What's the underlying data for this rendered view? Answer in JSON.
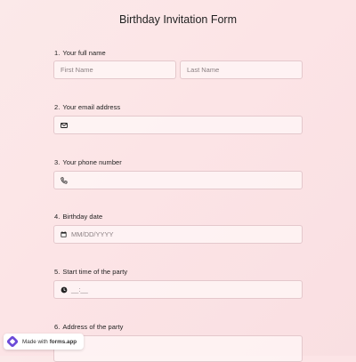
{
  "form": {
    "title": "Birthday Invitation Form"
  },
  "questions": [
    {
      "number": "1.",
      "label": "Your full name",
      "fields": [
        {
          "placeholder": "First Name"
        },
        {
          "placeholder": "Last Name"
        }
      ]
    },
    {
      "number": "2.",
      "label": "Your email address",
      "fields": [
        {
          "placeholder": "",
          "icon": "envelope-icon"
        }
      ]
    },
    {
      "number": "3.",
      "label": "Your phone number",
      "fields": [
        {
          "placeholder": "",
          "icon": "phone-icon"
        }
      ]
    },
    {
      "number": "4.",
      "label": "Birthday date",
      "fields": [
        {
          "placeholder": "MM/DD/YYYY",
          "icon": "calendar-icon"
        }
      ]
    },
    {
      "number": "5.",
      "label": "Start time of the party",
      "fields": [
        {
          "placeholder": "__:__",
          "icon": "clock-icon"
        }
      ]
    },
    {
      "number": "6.",
      "label": "Address of the party",
      "fields": [
        {
          "placeholder": ""
        }
      ]
    }
  ],
  "badge": {
    "prefix": "Made with",
    "brand": "forms.app",
    "icon": "forms-app-logo-icon"
  },
  "colors": {
    "background": "#fce4e6",
    "field_border": "#e4c8cc",
    "logo_accent": "#6c4bd8"
  }
}
